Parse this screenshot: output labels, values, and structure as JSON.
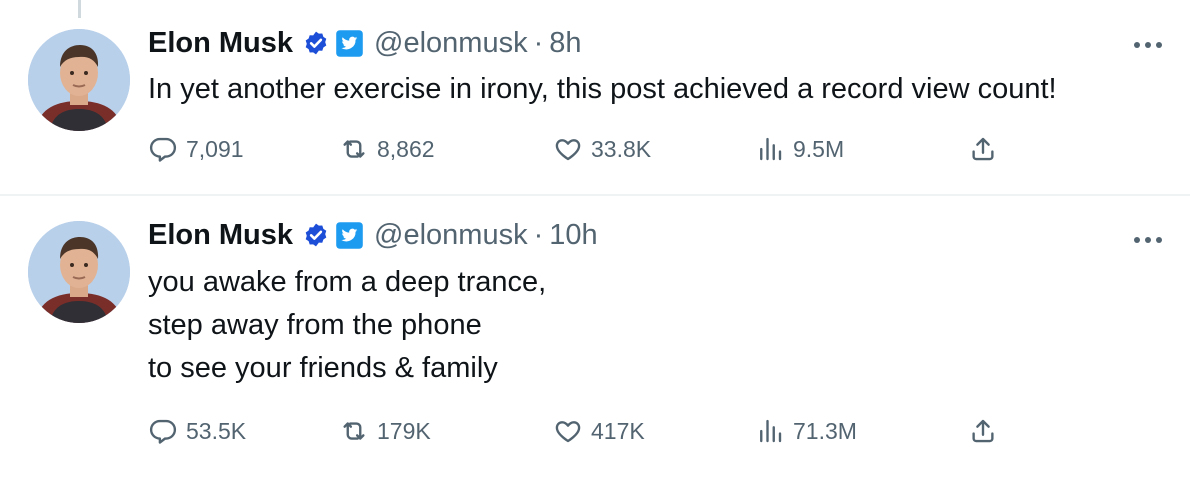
{
  "tweets": [
    {
      "author": "Elon Musk",
      "handle": "@elonmusk",
      "separator": "·",
      "time": "8h",
      "text_lines": [
        "In yet another exercise in irony, this post achieved a record view count!"
      ],
      "stats": {
        "replies": "7,091",
        "retweets": "8,862",
        "likes": "33.8K",
        "views": "9.5M"
      }
    },
    {
      "author": "Elon Musk",
      "handle": "@elonmusk",
      "separator": "·",
      "time": "10h",
      "text_lines": [
        "you awake from a deep trance,",
        "step away from the phone",
        "to see your friends & family"
      ],
      "stats": {
        "replies": "53.5K",
        "retweets": "179K",
        "likes": "417K",
        "views": "71.3M"
      }
    }
  ],
  "icons": {
    "verified": "verified-badge-icon",
    "gov": "twitter-bird-badge-icon",
    "reply": "reply-icon",
    "retweet": "retweet-icon",
    "like": "heart-icon",
    "views": "views-chart-icon",
    "share": "share-icon",
    "more": "more-options-icon"
  },
  "colors": {
    "accent": "#1d9bf0",
    "verified_blue": "#1d4ed8",
    "muted": "#536471",
    "text": "#0f1419"
  }
}
